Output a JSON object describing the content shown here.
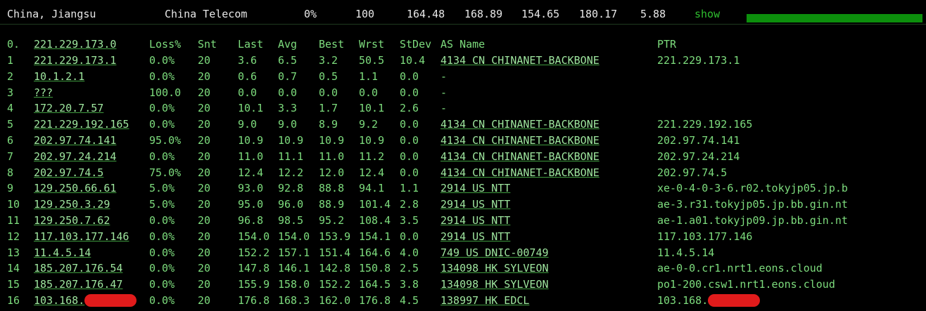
{
  "topbar": {
    "location": "China, Jiangsu",
    "isp": "China Telecom",
    "loss": "0%",
    "count": "100",
    "v1": "164.48",
    "v2": "168.89",
    "v3": "154.65",
    "v4": "180.17",
    "v5": "5.88",
    "show_label": "show",
    "progress": 1.0,
    "progress_color": "#0c8f0c"
  },
  "table": {
    "headers": {
      "num": "0.",
      "host": "221.229.173.0",
      "loss": "Loss%",
      "snt": "Snt",
      "last": "Last",
      "avg": "Avg",
      "best": "Best",
      "wrst": "Wrst",
      "stdev": "StDev",
      "as": "AS Name",
      "ptr": "PTR"
    },
    "rows": [
      {
        "num": "1",
        "host": "221.229.173.1",
        "loss": "0.0%",
        "snt": "20",
        "last": "3.6",
        "avg": "6.5",
        "best": "3.2",
        "wrst": "50.5",
        "stdev": "10.4",
        "as": "4134  CN CHINANET-BACKBONE",
        "as_link": true,
        "ptr": "221.229.173.1"
      },
      {
        "num": "2",
        "host": "10.1.2.1",
        "loss": "0.0%",
        "snt": "20",
        "last": "0.6",
        "avg": "0.7",
        "best": "0.5",
        "wrst": "1.1",
        "stdev": "0.0",
        "as": "-",
        "as_link": false,
        "ptr": ""
      },
      {
        "num": "3",
        "host": "???",
        "loss": "100.0",
        "snt": "20",
        "last": "0.0",
        "avg": "0.0",
        "best": "0.0",
        "wrst": "0.0",
        "stdev": "0.0",
        "as": "-",
        "as_link": false,
        "ptr": ""
      },
      {
        "num": "4",
        "host": "172.20.7.57",
        "loss": "0.0%",
        "snt": "20",
        "last": "10.1",
        "avg": "3.3",
        "best": "1.7",
        "wrst": "10.1",
        "stdev": "2.6",
        "as": "-",
        "as_link": false,
        "ptr": ""
      },
      {
        "num": "5",
        "host": "221.229.192.165",
        "loss": "0.0%",
        "snt": "20",
        "last": "9.0",
        "avg": "9.0",
        "best": "8.9",
        "wrst": "9.2",
        "stdev": "0.0",
        "as": "4134  CN CHINANET-BACKBONE",
        "as_link": true,
        "ptr": "221.229.192.165"
      },
      {
        "num": "6",
        "host": "202.97.74.141",
        "loss": "95.0%",
        "snt": "20",
        "last": "10.9",
        "avg": "10.9",
        "best": "10.9",
        "wrst": "10.9",
        "stdev": "0.0",
        "as": "4134  CN CHINANET-BACKBONE",
        "as_link": true,
        "ptr": "202.97.74.141"
      },
      {
        "num": "7",
        "host": "202.97.24.214",
        "loss": "0.0%",
        "snt": "20",
        "last": "11.0",
        "avg": "11.1",
        "best": "11.0",
        "wrst": "11.2",
        "stdev": "0.0",
        "as": "4134  CN CHINANET-BACKBONE",
        "as_link": true,
        "ptr": "202.97.24.214"
      },
      {
        "num": "8",
        "host": "202.97.74.5",
        "loss": "75.0%",
        "snt": "20",
        "last": "12.4",
        "avg": "12.2",
        "best": "12.0",
        "wrst": "12.4",
        "stdev": "0.0",
        "as": "4134  CN CHINANET-BACKBONE",
        "as_link": true,
        "ptr": "202.97.74.5"
      },
      {
        "num": "9",
        "host": "129.250.66.61",
        "loss": "5.0%",
        "snt": "20",
        "last": "93.0",
        "avg": "92.8",
        "best": "88.8",
        "wrst": "94.1",
        "stdev": "1.1",
        "as": "2914  US NTT",
        "as_link": true,
        "ptr": "xe-0-4-0-3-6.r02.tokyjp05.jp.b"
      },
      {
        "num": "10",
        "host": "129.250.3.29",
        "loss": "5.0%",
        "snt": "20",
        "last": "95.0",
        "avg": "96.0",
        "best": "88.9",
        "wrst": "101.4",
        "stdev": "2.8",
        "as": "2914  US NTT",
        "as_link": true,
        "ptr": "ae-3.r31.tokyjp05.jp.bb.gin.nt"
      },
      {
        "num": "11",
        "host": "129.250.7.62",
        "loss": "0.0%",
        "snt": "20",
        "last": "96.8",
        "avg": "98.5",
        "best": "95.2",
        "wrst": "108.4",
        "stdev": "3.5",
        "as": "2914  US NTT",
        "as_link": true,
        "ptr": "ae-1.a01.tokyjp09.jp.bb.gin.nt"
      },
      {
        "num": "12",
        "host": "117.103.177.146",
        "loss": "0.0%",
        "snt": "20",
        "last": "154.0",
        "avg": "154.0",
        "best": "153.9",
        "wrst": "154.1",
        "stdev": "0.0",
        "as": "2914  US NTT",
        "as_link": true,
        "ptr": "117.103.177.146"
      },
      {
        "num": "13",
        "host": "11.4.5.14",
        "loss": "0.0%",
        "snt": "20",
        "last": "152.2",
        "avg": "157.1",
        "best": "151.4",
        "wrst": "164.6",
        "stdev": "4.0",
        "as": "749   US DNIC-00749",
        "as_link": true,
        "ptr": "11.4.5.14"
      },
      {
        "num": "14",
        "host": "185.207.176.54",
        "loss": "0.0%",
        "snt": "20",
        "last": "147.8",
        "avg": "146.1",
        "best": "142.8",
        "wrst": "150.8",
        "stdev": "2.5",
        "as": "134098 HK SYLVEON",
        "as_link": true,
        "ptr": "ae-0-0.cr1.nrt1.eons.cloud"
      },
      {
        "num": "15",
        "host": "185.207.176.47",
        "loss": "0.0%",
        "snt": "20",
        "last": "155.9",
        "avg": "158.0",
        "best": "152.2",
        "wrst": "164.5",
        "stdev": "3.8",
        "as": "134098 HK SYLVEON",
        "as_link": true,
        "ptr": "po1-200.csw1.nrt1.eons.cloud"
      },
      {
        "num": "16",
        "host": "103.168.",
        "loss": "0.0%",
        "snt": "20",
        "last": "176.8",
        "avg": "168.3",
        "best": "162.0",
        "wrst": "176.8",
        "stdev": "4.5",
        "as": "138997 HK EDCL",
        "as_link": true,
        "ptr": "103.168.",
        "redacted": true
      }
    ]
  },
  "colors": {
    "background": "#000000",
    "text_green": "#7ddc7d",
    "link_green": "#9fe79f",
    "redaction": "#e11b1b"
  }
}
